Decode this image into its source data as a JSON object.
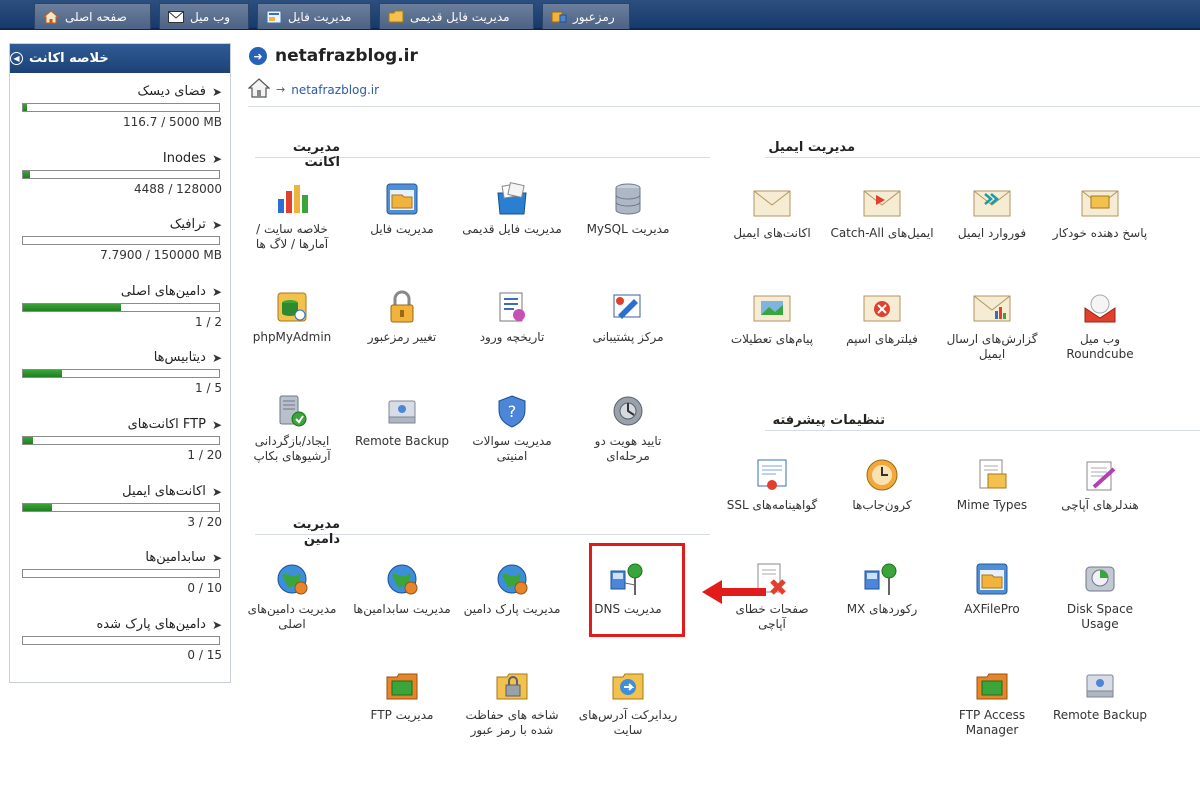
{
  "topnav": {
    "tabs": [
      {
        "label": "صفحه اصلی",
        "icon": "home-icon"
      },
      {
        "label": "وب میل",
        "icon": "mail-icon"
      },
      {
        "label": "مدیریت فایل",
        "icon": "file-manager-icon"
      },
      {
        "label": "مدیریت فایل قدیمی",
        "icon": "folder-icon"
      },
      {
        "label": "رمزعبور",
        "icon": "password-icon"
      }
    ]
  },
  "sidebar": {
    "title": "خلاصه اکانت",
    "items": [
      {
        "label": "فضای دیسک",
        "value": "116.7 / 5000 MB",
        "fill": 0.02
      },
      {
        "label": "Inodes",
        "value": "4488 / 128000",
        "fill": 0.035
      },
      {
        "label": "ترافیک",
        "value": "7.7900 / 150000 MB",
        "fill": 0.0
      },
      {
        "label": "دامین‌های اصلی",
        "value": "1 / 2",
        "fill": 0.5
      },
      {
        "label": "دیتابیس‌ها",
        "value": "1 / 5",
        "fill": 0.2
      },
      {
        "label": "اکانت‌های FTP",
        "value": "1 / 20",
        "fill": 0.05
      },
      {
        "label": "اکانت‌های ایمیل",
        "value": "3 / 20",
        "fill": 0.15
      },
      {
        "label": "سابدامین‌ها",
        "value": "0 / 10",
        "fill": 0.0
      },
      {
        "label": "دامین‌های پارک شده",
        "value": "0 / 15",
        "fill": 0.0
      }
    ]
  },
  "header": {
    "domain": "netafrazblog.ir",
    "breadcrumb": "netafrazblog.ir"
  },
  "sections": {
    "account": "مدیریت اکانت",
    "email": "مدیریت ایمیل",
    "advanced": "تنظیمات پیشرفته",
    "domain": "مدیریت دامین"
  },
  "account_items": [
    "مدیریت MySQL",
    "مدیریت فایل قدیمی",
    "مدیریت فایل",
    "خلاصه سایت / آمارها / لاگ ها",
    "مرکز پشتیبانی",
    "تاریخچه ورود",
    "تغییر رمزعبور",
    "phpMyAdmin",
    "تایید هویت دو مرحله‌ای",
    "مدیریت سوالات امنیتی",
    "Remote Backup",
    "ایجاد/بازگردانی آرشیوهای بکاپ"
  ],
  "email_items": [
    "پاسخ دهنده خودکار",
    "فوروارد ایمیل",
    "ایمیل‌های Catch-All",
    "اکانت‌های ایمیل",
    "وب میل Roundcube",
    "گزارش‌های ارسال ایمیل",
    "فیلترهای اسپم",
    "پیام‌های تعطیلات"
  ],
  "advanced_items": [
    "هندلرهای آپاچی",
    "Mime Types",
    "کرون‌جاب‌ها",
    "گواهینامه‌های SSL",
    "Disk Space Usage",
    "AXFilePro",
    "رکوردهای MX",
    "صفحات خطای آپاچی",
    "Remote Backup",
    "FTP Access Manager"
  ],
  "domain_items": [
    "مدیریت DNS",
    "مدیریت پارک دامین",
    "مدیریت سابدامین‌ها",
    "مدیریت دامین‌های اصلی",
    "ریدایرکت آدرس‌های سایت",
    "شاخه های حفاظت شده با رمز عبور",
    "مدیریت FTP"
  ],
  "colors": {
    "topbar": "#1b3f70",
    "accent": "#2562b8",
    "highlight": "#e21b1b",
    "progress": "#2b8f2b"
  }
}
